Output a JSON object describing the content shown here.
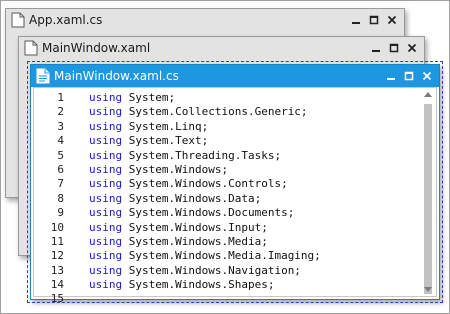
{
  "windows": [
    {
      "title": "App.xaml.cs",
      "state": "inactive"
    },
    {
      "title": "MainWindow.xaml",
      "state": "inactive"
    },
    {
      "title": "MainWindow.xaml.cs",
      "state": "active"
    }
  ],
  "window_controls": {
    "minimize": "minimize-icon",
    "maximize": "maximize-icon",
    "close": "close-icon"
  },
  "colors": {
    "active_titlebar": "#1c97e0",
    "inactive_window": "#e3e3e3",
    "keyword": "#1a1acc",
    "focus_outline": "#2c3cc8"
  },
  "editor": {
    "lines": [
      {
        "num": "1",
        "kw": "using",
        "text": " System;"
      },
      {
        "num": "2",
        "kw": "using",
        "text": " System.Collections.Generic;"
      },
      {
        "num": "3",
        "kw": "using",
        "text": " System.Linq;"
      },
      {
        "num": "4",
        "kw": "using",
        "text": " System.Text;"
      },
      {
        "num": "5",
        "kw": "using",
        "text": " System.Threading.Tasks;"
      },
      {
        "num": "6",
        "kw": "using",
        "text": " System.Windows;"
      },
      {
        "num": "7",
        "kw": "using",
        "text": " System.Windows.Controls;"
      },
      {
        "num": "8",
        "kw": "using",
        "text": " System.Windows.Data;"
      },
      {
        "num": "9",
        "kw": "using",
        "text": " System.Windows.Documents;"
      },
      {
        "num": "10",
        "kw": "using",
        "text": " System.Windows.Input;"
      },
      {
        "num": "11",
        "kw": "using",
        "text": " System.Windows.Media;"
      },
      {
        "num": "12",
        "kw": "using",
        "text": " System.Windows.Media.Imaging;"
      },
      {
        "num": "13",
        "kw": "using",
        "text": " System.Windows.Navigation;"
      },
      {
        "num": "14",
        "kw": "using",
        "text": " System.Windows.Shapes;"
      },
      {
        "num": "15",
        "kw": "",
        "text": ""
      }
    ]
  }
}
